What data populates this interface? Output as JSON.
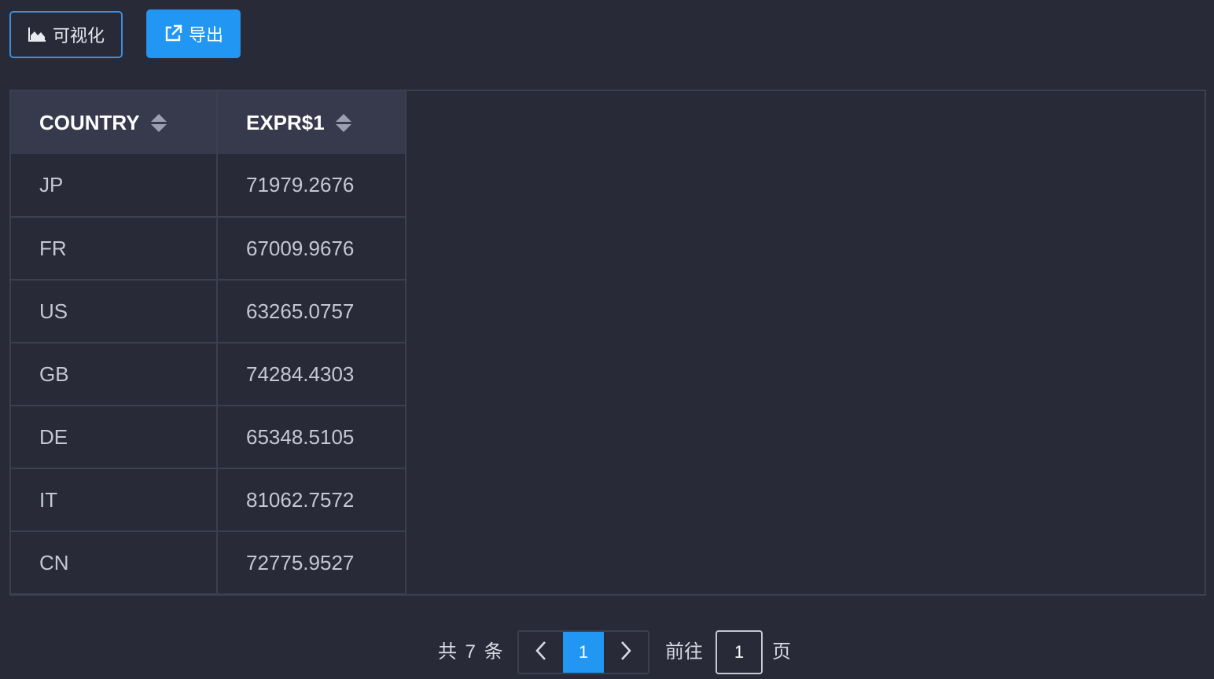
{
  "toolbar": {
    "visualize_label": "可视化",
    "visualize_icon": "area-chart-icon",
    "export_label": "导出",
    "export_icon": "external-link-icon"
  },
  "table": {
    "columns": [
      "COUNTRY",
      "EXPR$1"
    ],
    "rows": [
      [
        "JP",
        "71979.2676"
      ],
      [
        "FR",
        "67009.9676"
      ],
      [
        "US",
        "63265.0757"
      ],
      [
        "GB",
        "74284.4303"
      ],
      [
        "DE",
        "65348.5105"
      ],
      [
        "IT",
        "81062.7572"
      ],
      [
        "CN",
        "72775.9527"
      ]
    ]
  },
  "pagination": {
    "total_text": "共 7 条",
    "current_page": "1",
    "goto_label": "前往",
    "goto_value": "1",
    "page_suffix": "页"
  },
  "colors": {
    "background": "#282a38",
    "accent": "#2196f3",
    "header_bg": "#363a4c",
    "border": "#3b3f50"
  }
}
